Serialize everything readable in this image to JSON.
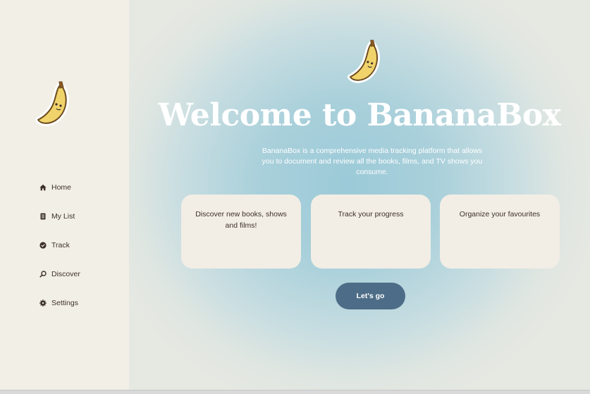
{
  "app": {
    "name": "BananaBox",
    "logo_icon": "banana-icon"
  },
  "sidebar": {
    "items": [
      {
        "label": "Home",
        "icon": "home-icon"
      },
      {
        "label": "My List",
        "icon": "list-icon"
      },
      {
        "label": "Track",
        "icon": "check-circle-icon"
      },
      {
        "label": "Discover",
        "icon": "search-icon"
      },
      {
        "label": "Settings",
        "icon": "gear-icon"
      }
    ]
  },
  "hero": {
    "title": "Welcome to BananaBox",
    "description": "BananaBox is a comprehensive media tracking platform that allows you to document and review all the books, films, and TV shows you consume."
  },
  "features": [
    {
      "text": "Discover new books, shows and films!"
    },
    {
      "text": "Track your progress"
    },
    {
      "text": "Organize your favourites"
    }
  ],
  "cta": {
    "label": "Let's go"
  },
  "colors": {
    "sidebar_bg": "#f2efe6",
    "card_bg": "#f2eee5",
    "button_bg": "#4d6c87",
    "text_dark": "#3c302b",
    "hero_blue": "#9ccad8"
  }
}
